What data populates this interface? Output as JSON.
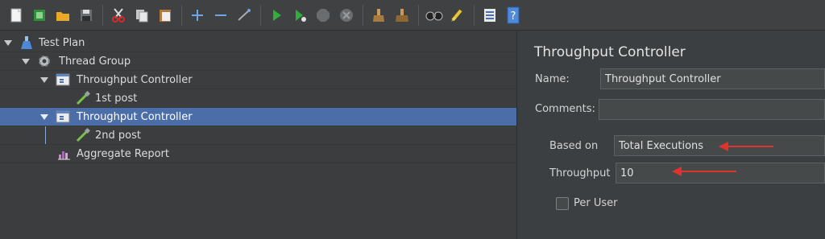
{
  "toolbar": {
    "icons": [
      "new-icon",
      "templates-icon",
      "open-icon",
      "save-icon",
      "cut-icon",
      "copy-icon",
      "paste-icon",
      "expand-icon",
      "collapse-icon",
      "toggle-icon",
      "start-icon",
      "start-no-pause-icon",
      "stop-icon",
      "shutdown-icon",
      "clear-icon",
      "clear-all-icon",
      "search-icon",
      "reset-search-icon",
      "function-helper-icon",
      "help-icon"
    ]
  },
  "tree": {
    "items": [
      {
        "label": "Test Plan",
        "icon": "flask-icon"
      },
      {
        "label": "Thread Group",
        "icon": "gear-icon"
      },
      {
        "label": "Throughput Controller",
        "icon": "controller-icon"
      },
      {
        "label": "1st post",
        "icon": "pipette-icon"
      },
      {
        "label": "Throughput Controller",
        "icon": "controller-icon",
        "selected": true
      },
      {
        "label": "2nd post",
        "icon": "pipette-icon"
      },
      {
        "label": "Aggregate Report",
        "icon": "report-icon"
      }
    ]
  },
  "panel": {
    "title": "Throughput Controller",
    "name_label": "Name:",
    "name_value": "Throughput Controller",
    "comments_label": "Comments:",
    "comments_value": "",
    "based_on_label": "Based on",
    "based_on_value": "Total Executions",
    "throughput_label": "Throughput",
    "throughput_value": "10",
    "per_user_label": "Per User",
    "per_user_checked": false
  },
  "colors": {
    "selection": "#4b6ea8",
    "annotation_arrow": "#e0332b"
  }
}
